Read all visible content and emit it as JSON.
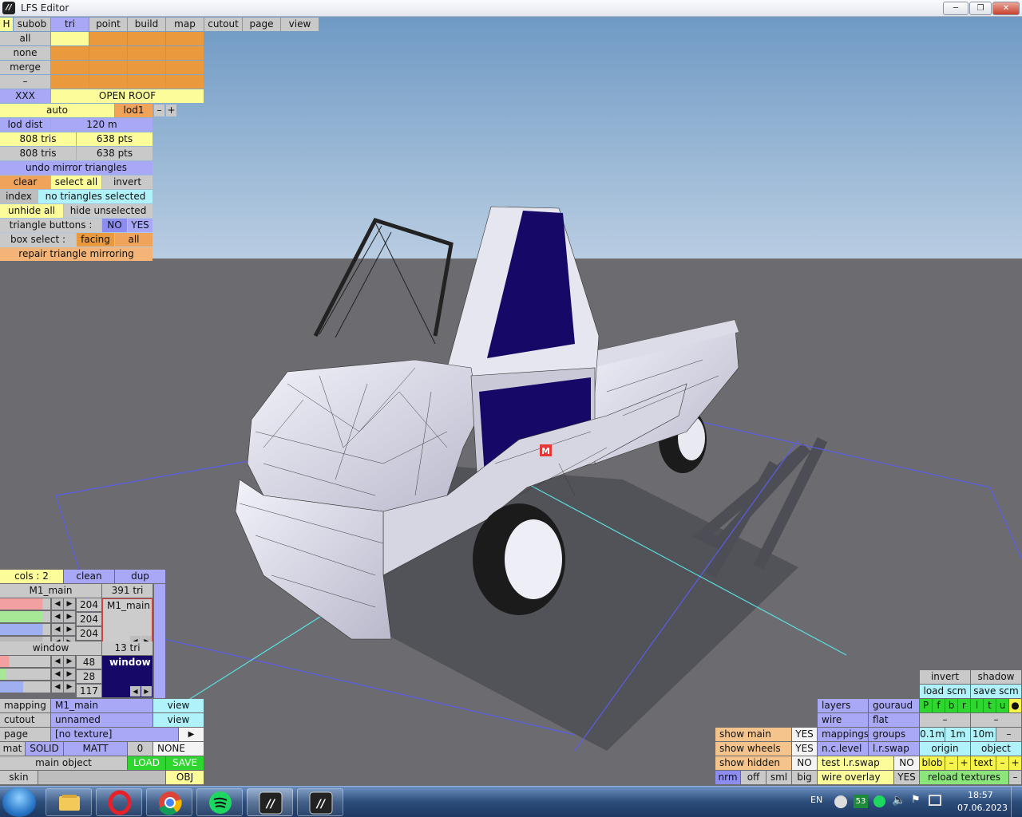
{
  "window": {
    "title": "LFS Editor",
    "app_icon": "lfs-logo-icon",
    "buttons": [
      "─",
      "❐",
      "✕"
    ]
  },
  "tabs": [
    {
      "label": "H",
      "active": false
    },
    {
      "label": "subob",
      "active": false
    },
    {
      "label": "tri",
      "active": true
    },
    {
      "label": "point",
      "active": false
    },
    {
      "label": "build",
      "active": false
    },
    {
      "label": "map",
      "active": false
    },
    {
      "label": "cutout",
      "active": false
    },
    {
      "label": "page",
      "active": false
    },
    {
      "label": "view",
      "active": false
    }
  ],
  "select_panel": {
    "rows": [
      "all",
      "none",
      "merge",
      "–"
    ],
    "xxx": "XXX",
    "open_roof": "OPEN ROOF",
    "auto": "auto",
    "lod": "lod1",
    "lod_minus": "–",
    "lod_plus": "+",
    "lod_dist_label": "lod dist",
    "lod_dist_value": "120 m",
    "tris1": "808 tris",
    "pts1": "638 pts",
    "tris2": "808 tris",
    "pts2": "638 pts",
    "undo_mirror": "undo mirror triangles",
    "clear": "clear",
    "select_all": "select all",
    "invert": "invert",
    "index": "index",
    "index_status": "no triangles selected",
    "unhide_all": "unhide all",
    "hide_unselected": "hide unselected",
    "triangle_buttons": "triangle buttons :",
    "tb_no": "NO",
    "tb_yes": "YES",
    "box_select": "box select :",
    "facing": "facing",
    "all": "all",
    "repair": "repair triangle mirroring"
  },
  "object_panel": {
    "cols": "cols : 2",
    "clean": "clean",
    "dup": "dup",
    "sub1_name": "M1_main",
    "sub1_tri": "391 tri",
    "sub1_vals": [
      "204",
      "204",
      "204"
    ],
    "sub1_swatch": "M1_main",
    "sub2_name": "window",
    "sub2_tri": "13 tri",
    "sub2_vals": [
      "48",
      "28",
      "117"
    ],
    "sub2_swatch": "window",
    "mapping_label": "mapping",
    "mapping_value": "M1_main",
    "cutout_label": "cutout",
    "cutout_value": "unnamed",
    "view": "view",
    "page_label": "page",
    "page_value": "[no texture]",
    "mat": "mat",
    "solid": "SOLID",
    "matt": "MATT",
    "zero": "0",
    "none": "NONE",
    "main_object": "main object",
    "load": "LOAD",
    "save": "SAVE",
    "skin": "skin",
    "obj": "OBJ"
  },
  "view_panel": {
    "invert": "invert",
    "shadow": "shadow",
    "load_scm": "load scm",
    "save_scm": "save scm",
    "layers": "layers",
    "gouraud": "gouraud",
    "wire": "wire",
    "flat": "flat",
    "flags": [
      "P",
      "f",
      "b",
      "r",
      "l",
      "t",
      "u",
      "●"
    ],
    "dash": "–",
    "show_main": "show main",
    "show_main_val": "YES",
    "show_wheels": "show wheels",
    "show_wheels_val": "YES",
    "show_hidden": "show hidden",
    "show_hidden_val": "NO",
    "mappings": "mappings",
    "groups": "groups",
    "nc_level": "n.c.level",
    "lr_swap": "l.r.swap",
    "test_lr_swap": "test l.r.swap",
    "test_lr_val": "NO",
    "wire_overlay": "wire overlay",
    "wire_overlay_val": "YES",
    "grid": [
      "0.1m",
      "1m",
      "10m"
    ],
    "origin": "origin",
    "object": "object",
    "blob": "blob",
    "text": "text",
    "minus": "–",
    "plus": "+",
    "reload_textures": "reload textures",
    "nrm": "nrm",
    "off": "off",
    "sml": "sml",
    "big": "big"
  },
  "scene": {
    "marker": "M",
    "sky_top": "#6f9ac4",
    "sky_bottom": "#b9cde2",
    "ground": "#6c6c70",
    "window_color": "#160866"
  },
  "taskbar": {
    "apps": [
      "explorer-icon",
      "opera-icon",
      "chrome-icon",
      "spotify-icon",
      "lfs-icon",
      "lfs-icon"
    ],
    "lang": "EN",
    "badge": "53",
    "time": "18:57",
    "date": "07.06.2023"
  }
}
